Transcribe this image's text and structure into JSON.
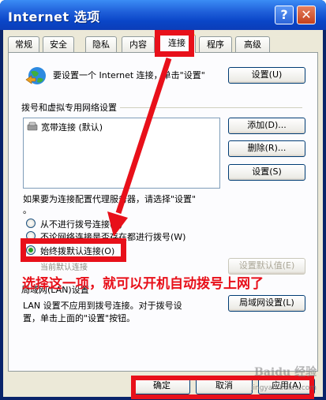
{
  "window": {
    "title": "Internet 选项",
    "help_label": "?",
    "close_label": "✕"
  },
  "tabs": [
    {
      "label": "常规"
    },
    {
      "label": "安全"
    },
    {
      "label": "隐私"
    },
    {
      "label": "内容"
    },
    {
      "label": "连接",
      "active": true
    },
    {
      "label": "程序"
    },
    {
      "label": "高级"
    }
  ],
  "setup": {
    "text": "要设置一个 Internet 连接，单击\"设置\"",
    "button": "设置(U)"
  },
  "dialup": {
    "group_title": "拨号和虚拟专用网络设置",
    "connections": [
      {
        "name": "宽带连接 (默认)",
        "icon": "dialup-connection-icon"
      }
    ],
    "add_button": "添加(D)...",
    "remove_button": "删除(R)...",
    "settings_button": "设置(S)",
    "proxy_note_line1": "如果要为连接配置代理服务器，请选择\"设置\"",
    "proxy_note_line2": "。",
    "options": [
      {
        "label": "从不进行拨号连接(C)",
        "checked": false
      },
      {
        "label": "不论网络连接是否存在都进行拨号(W)",
        "checked": false
      },
      {
        "label": "始终拨默认连接(O)",
        "checked": true
      }
    ],
    "current_label": "当前默认连接",
    "default_button": "设置默认值(E)"
  },
  "lan": {
    "group_title": "局域网(LAN)设置",
    "desc_line1": "LAN 设置不应用到拨号连接。对于拨号设",
    "desc_line2": "置，单击上面的\"设置\"按钮。",
    "button": "局域网设置(L)"
  },
  "footer": {
    "ok": "确定",
    "cancel": "取消",
    "apply": "应用(A)"
  },
  "annotation": {
    "text": "选择这一项，就可以开机自动拨号上网了",
    "color": "#e8101a"
  },
  "watermark": {
    "text": "Baidu 经验",
    "url": "jingyan.baidu.com"
  }
}
